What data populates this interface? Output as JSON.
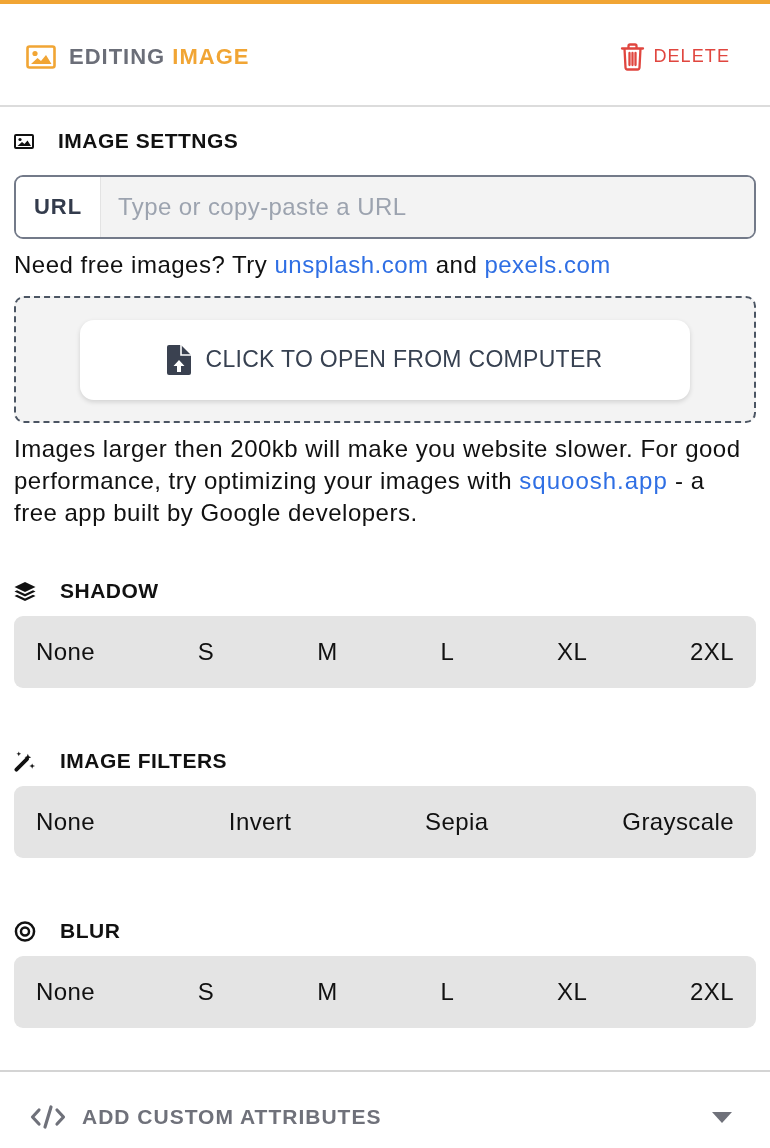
{
  "header": {
    "title": "EDITING",
    "title_subject": "IMAGE",
    "delete_label": "DELETE"
  },
  "image_settings": {
    "title": "IMAGE SETTNGS",
    "url_field": {
      "label": "URL",
      "placeholder": "Type or copy-paste a URL"
    },
    "hint": [
      {
        "kind": "text",
        "text": "Need free images? Try "
      },
      {
        "kind": "link",
        "text": "unsplash.com"
      },
      {
        "kind": "text",
        "text": " and "
      },
      {
        "kind": "link",
        "text": "pexels.com"
      }
    ],
    "upload_button": "CLICK TO OPEN FROM COMPUTER",
    "note": [
      {
        "kind": "text",
        "text": "Images larger then 200kb will make you website slower. For good performance, try optimizing your images with "
      },
      {
        "kind": "link",
        "text": "squoosh.app"
      },
      {
        "kind": "text",
        "text": " - a free app built by Google developers."
      }
    ]
  },
  "option_groups": [
    {
      "title": "SHADOW",
      "options": [
        {
          "label": "None",
          "selected": false
        },
        {
          "label": "S",
          "selected": false
        },
        {
          "label": "M",
          "selected": false
        },
        {
          "label": "L",
          "selected": false
        },
        {
          "label": "XL",
          "selected": false
        },
        {
          "label": "2XL",
          "selected": false
        }
      ]
    },
    {
      "title": "IMAGE FILTERS",
      "options": [
        {
          "label": "None",
          "selected": false
        },
        {
          "label": "Invert",
          "selected": false
        },
        {
          "label": "Sepia",
          "selected": false
        },
        {
          "label": "Grayscale",
          "selected": false
        }
      ]
    },
    {
      "title": "BLUR",
      "options": [
        {
          "label": "None",
          "selected": false
        },
        {
          "label": "S",
          "selected": false
        },
        {
          "label": "M",
          "selected": false
        },
        {
          "label": "L",
          "selected": false
        },
        {
          "label": "XL",
          "selected": false
        },
        {
          "label": "2XL",
          "selected": false
        }
      ]
    }
  ],
  "footer": {
    "label": "ADD CUSTOM ATTRIBUTES",
    "expanded": false
  }
}
